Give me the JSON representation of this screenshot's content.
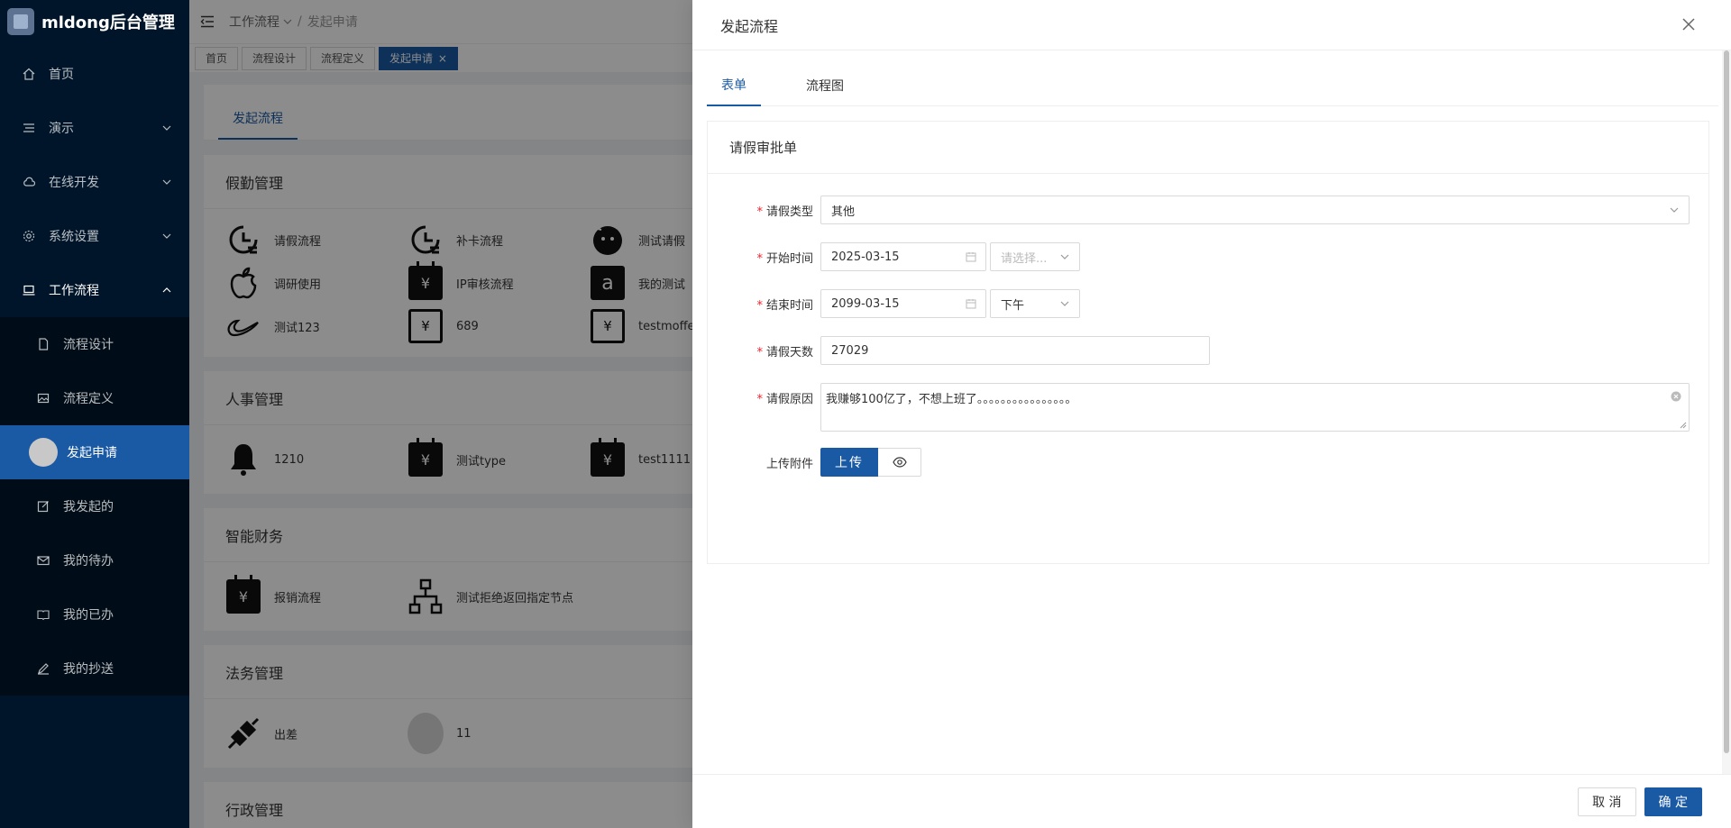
{
  "app": {
    "title": "mldong后台管理"
  },
  "sidebar": {
    "items": [
      {
        "label": "首页"
      },
      {
        "label": "演示"
      },
      {
        "label": "在线开发"
      },
      {
        "label": "系统设置"
      },
      {
        "label": "工作流程"
      }
    ],
    "sub_items": [
      {
        "label": "流程设计"
      },
      {
        "label": "流程定义"
      },
      {
        "label": "发起申请"
      },
      {
        "label": "我发起的"
      },
      {
        "label": "我的待办"
      },
      {
        "label": "我的已办"
      },
      {
        "label": "我的抄送"
      }
    ]
  },
  "breadcrumb": {
    "parent": "工作流程",
    "current": "发起申请"
  },
  "tabs": [
    {
      "label": "首页"
    },
    {
      "label": "流程设计"
    },
    {
      "label": "流程定义"
    },
    {
      "label": "发起申请"
    }
  ],
  "tab_close": "×",
  "page": {
    "tab": "发起流程",
    "categories": [
      {
        "title": "假勤管理",
        "items": [
          {
            "label": "请假流程"
          },
          {
            "label": "补卡流程"
          },
          {
            "label": "测试请假"
          },
          {
            "label": "调研使用"
          },
          {
            "label": "IP审核流程"
          },
          {
            "label": "我的测试"
          },
          {
            "label": "测试123"
          },
          {
            "label": "689"
          },
          {
            "label": "testmoffe"
          }
        ]
      },
      {
        "title": "人事管理",
        "items": [
          {
            "label": "1210"
          },
          {
            "label": "测试type"
          },
          {
            "label": "test1111"
          }
        ]
      },
      {
        "title": "智能财务",
        "items": [
          {
            "label": "报销流程"
          },
          {
            "label": "测试拒绝返回指定节点"
          }
        ]
      },
      {
        "title": "法务管理",
        "items": [
          {
            "label": "出差"
          },
          {
            "label": "11"
          }
        ]
      },
      {
        "title": "行政管理",
        "items": []
      }
    ]
  },
  "drawer": {
    "title": "发起流程",
    "tabs": [
      {
        "label": "表单"
      },
      {
        "label": "流程图"
      }
    ],
    "form_title": "请假审批单",
    "fields": {
      "leave_type": {
        "label": "请假类型",
        "value": "其他"
      },
      "start_time": {
        "label": "开始时间",
        "date": "2025-03-15",
        "period_placeholder": "请选择..."
      },
      "end_time": {
        "label": "结束时间",
        "date": "2099-03-15",
        "period": "下午"
      },
      "days": {
        "label": "请假天数",
        "value": "27029"
      },
      "reason": {
        "label": "请假原因",
        "value": "我赚够100亿了，不想上班了。。。。。。。。。。。。。。。。"
      },
      "attachment": {
        "label": "上传附件",
        "upload_label": "上传"
      }
    },
    "footer": {
      "cancel_label": "取 消",
      "ok_label": "确 定"
    }
  },
  "colors": {
    "primary": "#1a5aa4",
    "sidebar_bg": "#001529",
    "required": "#f5222d"
  }
}
